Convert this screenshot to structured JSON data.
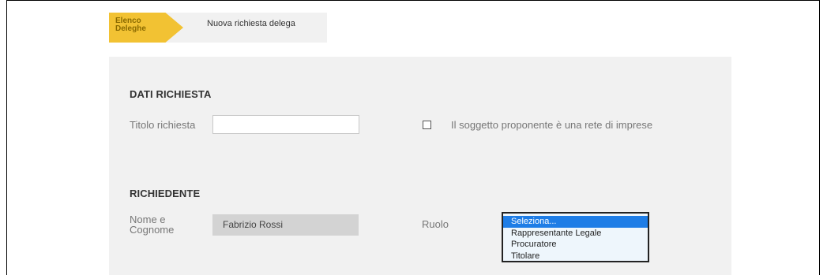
{
  "breadcrumb": {
    "active_label": "Elenco Deleghe",
    "current_label": "Nuova richiesta delega"
  },
  "dati_richiesta": {
    "section_title": "DATI RICHIESTA",
    "titolo_label": "Titolo richiesta",
    "titolo_value": "",
    "rete_checkbox_checked": false,
    "rete_checkbox_label": "Il soggetto proponente è una rete di imprese"
  },
  "richiedente": {
    "section_title": "RICHIEDENTE",
    "nome_label": "Nome e Cognome",
    "nome_value": "Fabrizio Rossi",
    "ruolo_label": "Ruolo",
    "ruolo_options": [
      "Seleziona...",
      "Rappresentante Legale",
      "Procuratore",
      "Titolare"
    ],
    "ruolo_selected": "Seleziona..."
  },
  "colors": {
    "breadcrumb_active": "#f2c233",
    "panel_bg": "#f1f1f1",
    "selected_option": "#1e7de6"
  }
}
